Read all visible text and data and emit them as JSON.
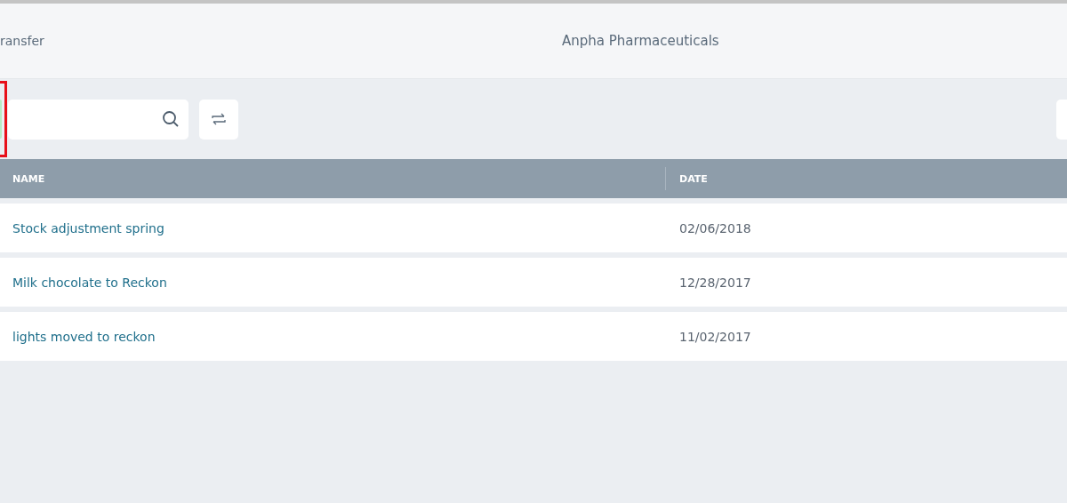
{
  "header": {
    "title": "ransfer",
    "company": "Anpha Pharmaceuticals"
  },
  "table": {
    "columns": [
      "NAME",
      "DATE"
    ],
    "rows": [
      {
        "name": "Stock adjustment spring",
        "date": "02/06/2018"
      },
      {
        "name": "Milk chocolate to Reckon",
        "date": "12/28/2017"
      },
      {
        "name": "lights moved to reckon",
        "date": "11/02/2017"
      }
    ]
  }
}
